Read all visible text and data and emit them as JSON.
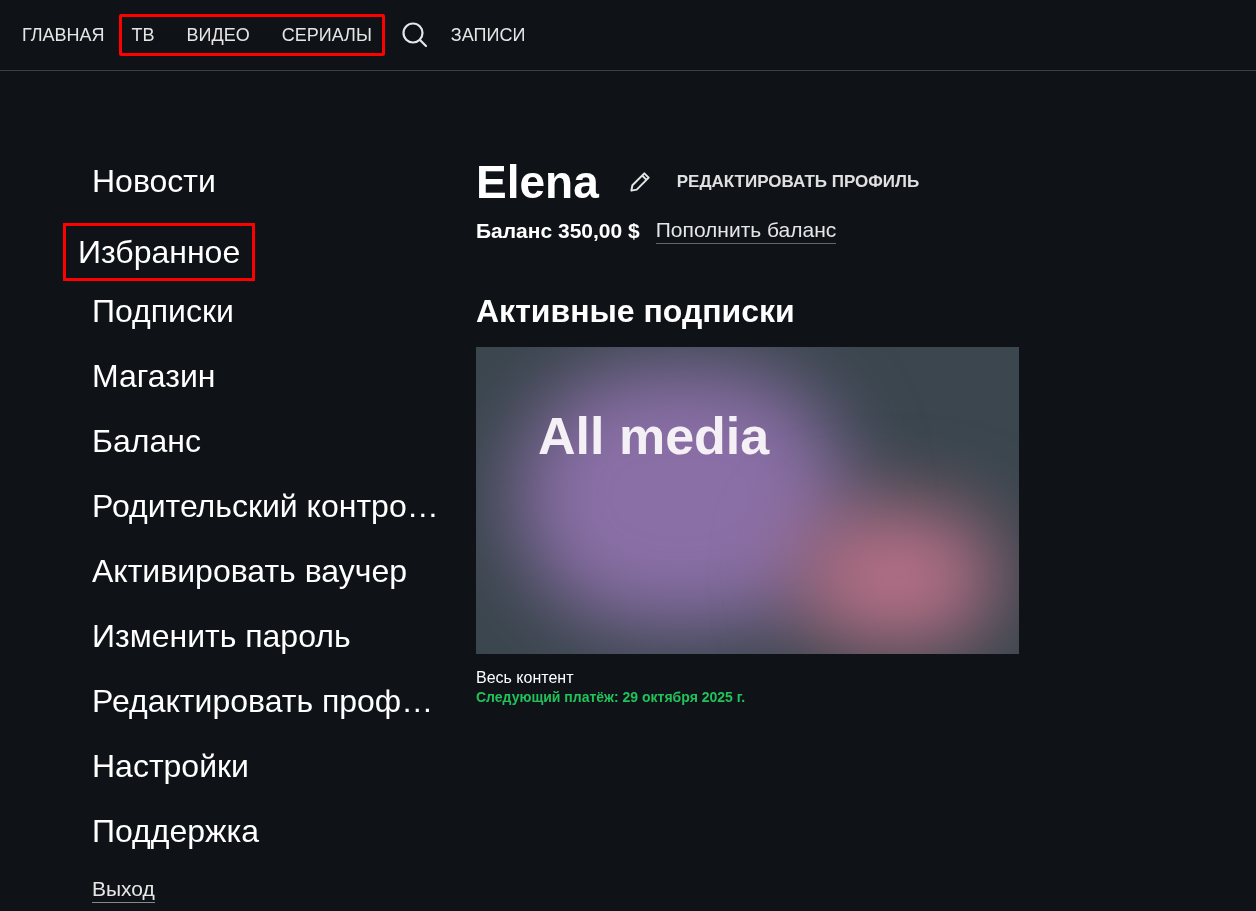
{
  "top_nav": [
    {
      "label": "ГЛАВНАЯ",
      "highlighted": false,
      "kind": "link"
    },
    {
      "label": "ТВ",
      "highlighted": true,
      "kind": "link"
    },
    {
      "label": "ВИДЕО",
      "highlighted": true,
      "kind": "link"
    },
    {
      "label": "СЕРИАЛЫ",
      "highlighted": true,
      "kind": "link"
    },
    {
      "kind": "search",
      "highlighted": false
    },
    {
      "label": "ЗАПИСИ",
      "highlighted": false,
      "kind": "link"
    }
  ],
  "sidebar": {
    "items": [
      {
        "label": "Новости",
        "highlighted": false
      },
      {
        "label": "Избранное",
        "highlighted": true
      },
      {
        "label": "Подписки",
        "highlighted": false
      },
      {
        "label": "Магазин",
        "highlighted": false
      },
      {
        "label": "Баланс",
        "highlighted": false
      },
      {
        "label": "Родительский контро…",
        "highlighted": false
      },
      {
        "label": "Активировать ваучер",
        "highlighted": false
      },
      {
        "label": "Изменить пароль",
        "highlighted": false
      },
      {
        "label": "Редактировать проф…",
        "highlighted": false
      },
      {
        "label": "Настройки",
        "highlighted": false
      },
      {
        "label": "Поддержка",
        "highlighted": false
      }
    ],
    "logout": "Выход"
  },
  "profile": {
    "name": "Elena",
    "edit_label": "РЕДАКТИРОВАТЬ ПРОФИЛЬ",
    "balance": "Баланс 350,00 $",
    "top_up": "Пополнить баланс"
  },
  "subscriptions": {
    "title": "Активные подписки",
    "items": [
      {
        "banner_title": "All media",
        "name": "Весь контент",
        "next_payment": "Следующий платёж: 29 октября 2025 г."
      }
    ]
  }
}
